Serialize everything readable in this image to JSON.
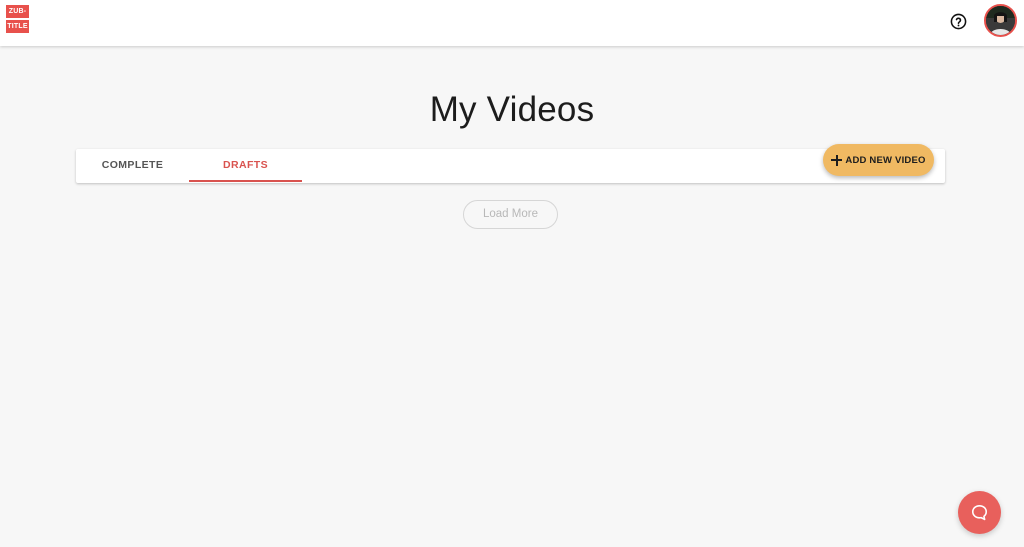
{
  "header": {
    "logo": {
      "line1": "ZUB-",
      "line2": "TITLE"
    },
    "help_icon": "help-circle-icon",
    "avatar": "user-avatar"
  },
  "main": {
    "title": "My Videos",
    "tabs": [
      {
        "label": "COMPLETE",
        "active": false
      },
      {
        "label": "DRAFTS",
        "active": true
      }
    ],
    "add_button_label": "ADD NEW VIDEO",
    "load_more_label": "Load More"
  },
  "chat": {
    "icon": "chat-bubble-icon"
  },
  "colors": {
    "brand_red": "#e8514c",
    "active_tab": "#d9534f",
    "add_button": "#f0b962",
    "background": "#f7f7f7"
  }
}
